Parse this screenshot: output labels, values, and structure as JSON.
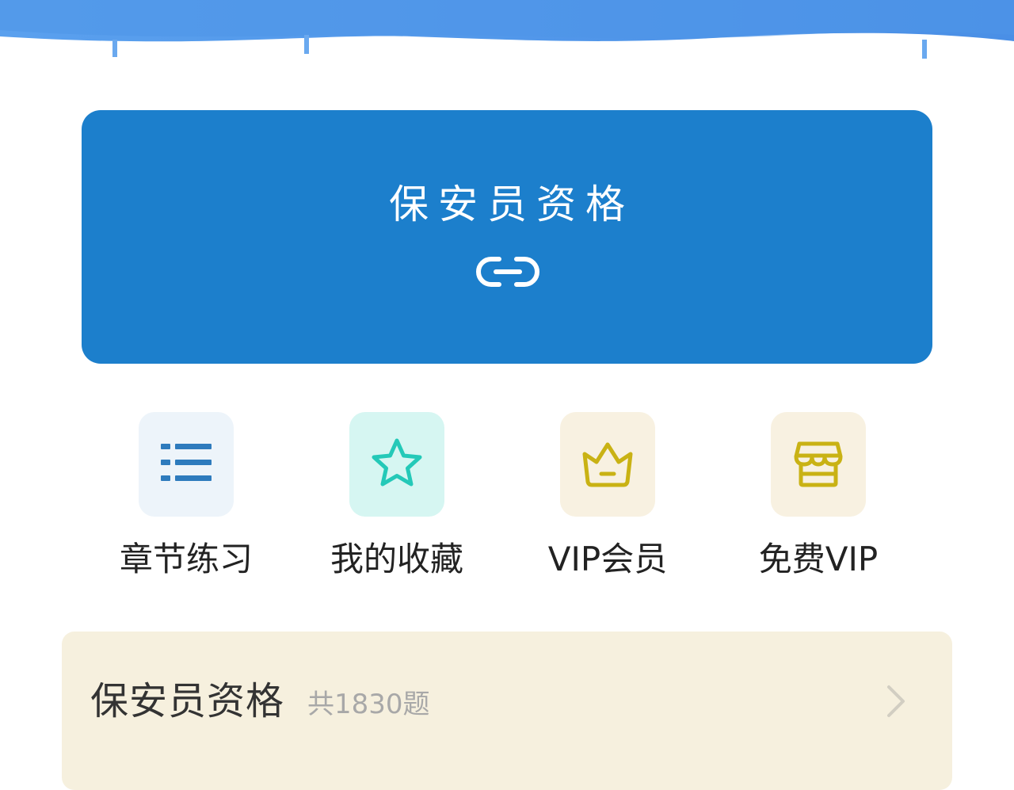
{
  "header": {
    "wave_color": "#4a90e2"
  },
  "hero": {
    "title": "保安员资格",
    "background_color": "#1c7fcc",
    "icon": "link-icon"
  },
  "actions": [
    {
      "label": "章节练习",
      "icon": "list-icon",
      "tile_color": "#edf4fa",
      "icon_color": "#2e7bbd"
    },
    {
      "label": "我的收藏",
      "icon": "star-icon",
      "tile_color": "#d6f6f2",
      "icon_color": "#24c9b8"
    },
    {
      "label": "VIP会员",
      "icon": "crown-icon",
      "tile_color": "#f8f1e1",
      "icon_color": "#c9b214"
    },
    {
      "label": "免费VIP",
      "icon": "store-icon",
      "tile_color": "#f8f1e1",
      "icon_color": "#c9b214"
    }
  ],
  "bank": {
    "title": "保安员资格",
    "count": "共1830题",
    "background_color": "#f6f0de",
    "icon": "chevron-right-icon"
  }
}
